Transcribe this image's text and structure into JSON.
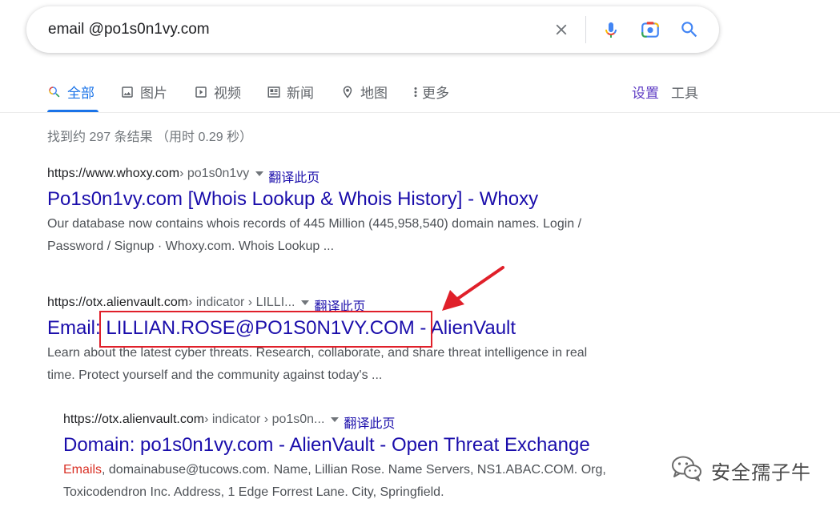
{
  "search": {
    "query": "email @po1s0n1vy.com"
  },
  "tabs": [
    {
      "label": "全部",
      "icon": "search-icon",
      "active": true
    },
    {
      "label": "图片",
      "icon": "image-icon"
    },
    {
      "label": "视频",
      "icon": "video-icon"
    },
    {
      "label": "新闻",
      "icon": "news-icon"
    },
    {
      "label": "地图",
      "icon": "map-pin-icon"
    },
    {
      "label": "更多",
      "icon": "more-vert-icon"
    }
  ],
  "tools": {
    "settings": "设置",
    "tools": "工具"
  },
  "stats": "找到约 297 条结果 （用时 0.29 秒）",
  "results": [
    {
      "domain": "https://www.whoxy.com",
      "path": " › po1s0n1vy",
      "translate": "翻译此页",
      "title": "Po1s0n1vy.com [Whois Lookup & Whois History] - Whoxy",
      "snippet_line1": "Our database now contains whois records of 445 Million (445,958,540) domain names. Login /",
      "snippet_line2": "Password / Signup · Whoxy.com. Whois Lookup ..."
    },
    {
      "domain": "https://otx.alienvault.com",
      "path": " › indicator › LILLI...",
      "translate": "翻译此页",
      "title_prefix": "Email: ",
      "title_highlight": "LILLIAN.ROSE@PO1S0N1VY.COM",
      "title_suffix": " - AlienVault",
      "snippet_line1": "Learn about the latest cyber threats. Research, collaborate, and share threat intelligence in real",
      "snippet_line2": "time. Protect yourself and the community against today's ..."
    },
    {
      "domain": "https://otx.alienvault.com",
      "path": " › indicator › po1s0n...",
      "translate": "翻译此页",
      "title": "Domain: po1s0n1vy.com - AlienVault - Open Threat Exchange",
      "snippet_emph": "Emails",
      "snippet_line1_rest": ", domainabuse@tucows.com. Name, Lillian Rose. Name Servers, NS1.ABAC.COM. Org,",
      "snippet_line2": "Toxicodendron Inc. Address, 1 Edge Forrest Lane. City, Springfield."
    }
  ],
  "watermark": {
    "text": "安全孺子牛",
    "icon": "wechat-icon"
  },
  "colors": {
    "link": "#1a0dab",
    "active_tab": "#1a73e8",
    "annotation": "#e0202a",
    "snippet_highlight": "#d93025"
  }
}
